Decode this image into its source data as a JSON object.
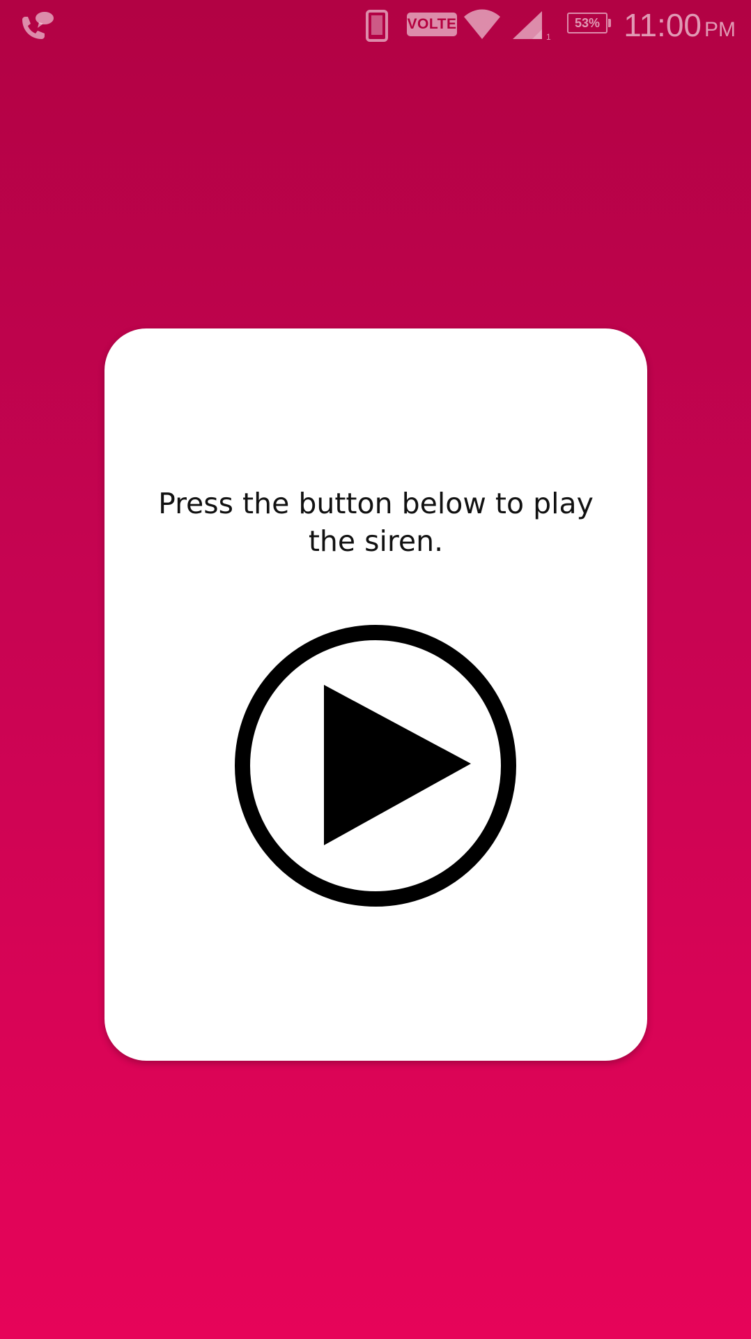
{
  "status_bar": {
    "left_icon": "call-chat-notification-icon",
    "icons": [
      "phone-icon",
      "volte-badge",
      "wifi-icon",
      "cell-signal-icon",
      "battery-icon"
    ],
    "volte_label": "VOLTE",
    "signal_sub": "1",
    "battery_percent": "53%",
    "time": "11:00",
    "ampm": "PM"
  },
  "card": {
    "instruction": "Press the button below to play the siren.",
    "play_button_icon": "play-circle-icon"
  },
  "colors": {
    "background_top": "#b20244",
    "background_bottom": "#e60459",
    "card": "#ffffff",
    "icon": "#000000"
  }
}
